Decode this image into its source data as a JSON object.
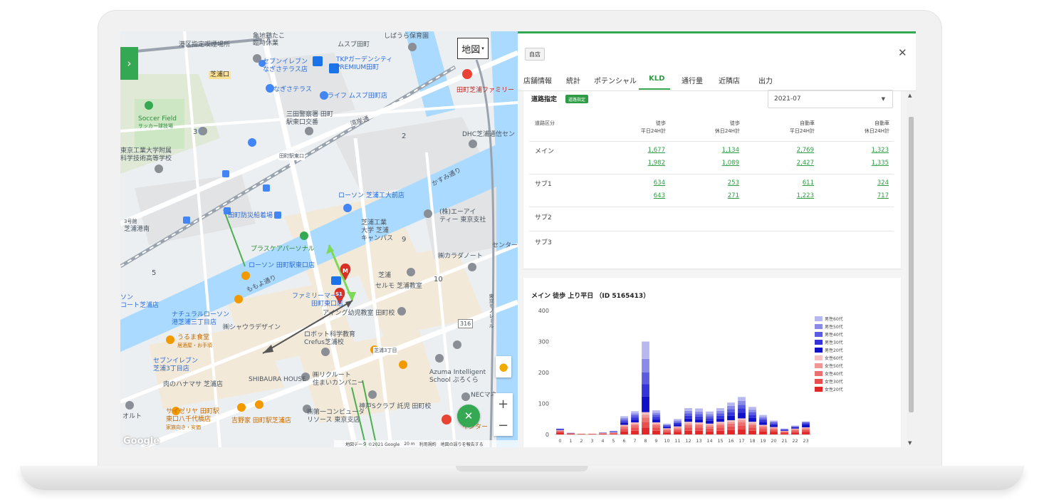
{
  "map": {
    "type_button": "地図",
    "labels": {
      "l1": "港区指定喫煙場所",
      "l2": "亀地鶏たこ",
      "l3": "臨時休業",
      "l4": "ムスブ田町",
      "l5": "しばうら保育園",
      "l6": "セブンイレブン",
      "l7": "なぎさテラス店",
      "l8": "TKPガーデンシティ",
      "l9": "PREMIUM田町",
      "l10": "芝浦口",
      "l11": "なぎさテラス",
      "l12": "ライフ ムスブ田町店",
      "l13": "田町芝浦ファミリー",
      "l14": "Soccer Field",
      "l15": "サッカー球技場",
      "l16": "三田警察署 田町",
      "l17": "駅東口交番",
      "l18": "湾岸通",
      "l19": "DHC芝浦通信セン",
      "l20": "東京工業大学附属",
      "l21": "科学技術高等学校",
      "l22": "田町駅東口",
      "l23": "かすみ通り",
      "l24": "ローソン 芝浦工大前店",
      "l25": "田町防災船着場",
      "l26": "(株)エーアイ",
      "l27": "ティー 東京支社",
      "l28": "3号館",
      "l29": "芝浦港南",
      "l30": "芝浦工業",
      "l31": "大学 芝浦",
      "l32": "キャンパス",
      "l33": "センター",
      "l34": "プラスケアパーソナル",
      "l35": "㈱カラダノート",
      "l36": "ローソン 田町駅東口店",
      "l37": "芝浦",
      "l38": "ももよ通り",
      "l39": "ファミリーマート",
      "l40": "田町東口店",
      "l41": "セルモ 芝浦教室",
      "l42": "ソン",
      "l43": "コート芝浦店",
      "l44": "アイング幼児教室 田町校",
      "l45": "ナチュラルローソン",
      "l46": "港芝浦三丁目店",
      "l47": "東京モノレール",
      "l48": "うるま食堂",
      "l49": "居酒屋・お手頃",
      "l50": "㈱シャウラデザイン",
      "l51": "ロボット科学教育",
      "l52": "Crefus芝浦校",
      "l53": "芝浦3丁目",
      "l54": "セブンイレブン",
      "l55": "芝浦3丁目店",
      "l56": "Azuma Intelligent",
      "l57": "School ぷろくら",
      "l58": "肉のハナマサ 芝浦店",
      "l59": "SHIBAURA HOUSE",
      "l60": "㈱リクルート",
      "l61": "住まいカンパニー",
      "l62": "NECマネ",
      "l63": "オルト",
      "l64": "サイゼリヤ 田町駅",
      "l65": "東口八千代橋店",
      "l66": "家族向き・安価",
      "l67": "吉野家 田町駅芝浦店",
      "l68": "㈱第一コンピュータ",
      "l69": "リソース 東京支店",
      "l70": "神戸Sクラブ 託児 田町校",
      "l71": "メン",
      "l72": "インター",
      "l73": "Google"
    },
    "numbers": [
      "3",
      "2",
      "9",
      "10",
      "5"
    ],
    "route_badge": "316",
    "markers": {
      "m": "M",
      "s1": "S1"
    },
    "footer": {
      "data": "地図データ ©2021 Google",
      "scale": "20 m",
      "terms": "利用規約",
      "report": "地図の誤りを報告する"
    }
  },
  "panel": {
    "store_badge": "自店",
    "tabs": [
      "店舗情報",
      "統計",
      "ポテンシャル",
      "KLD",
      "通行量",
      "近隣店",
      "出力"
    ],
    "active_tab": "KLD",
    "road": {
      "title": "道路指定",
      "badge": "道路指定",
      "month": "2021-07",
      "headers": [
        {
          "line1": "道路区分",
          "line2": ""
        },
        {
          "line1": "徒歩",
          "line2": "平日24H計"
        },
        {
          "line1": "徒歩",
          "line2": "休日24H計"
        },
        {
          "line1": "自動車",
          "line2": "平日24H計"
        },
        {
          "line1": "自動車",
          "line2": "休日24H計"
        }
      ],
      "rows": [
        {
          "label": "メイン",
          "values": [
            [
              "1,677",
              "1,982"
            ],
            [
              "1,134",
              "1,089"
            ],
            [
              "2,769",
              "2,427"
            ],
            [
              "1,323",
              "1,335"
            ]
          ]
        },
        {
          "label": "サブ1",
          "values": [
            [
              "634",
              "643"
            ],
            [
              "253",
              "271"
            ],
            [
              "611",
              "1,223"
            ],
            [
              "324",
              "717"
            ]
          ]
        },
        {
          "label": "サブ2",
          "values": []
        },
        {
          "label": "サブ3",
          "values": []
        }
      ]
    },
    "chart_title": "メイン 徒歩 上り平日 （ID 5165413）"
  },
  "chart_data": {
    "type": "bar",
    "stacked": true,
    "title": "メイン 徒歩 上り平日 （ID 5165413）",
    "categories": [
      "0",
      "1",
      "2",
      "3",
      "4",
      "5",
      "6",
      "7",
      "8",
      "9",
      "10",
      "11",
      "12",
      "13",
      "14",
      "15",
      "16",
      "17",
      "18",
      "19",
      "20",
      "21",
      "22",
      "23"
    ],
    "ylim": [
      0,
      400
    ],
    "yticks": [
      "0",
      "100",
      "200",
      "300",
      "400"
    ],
    "legend_position": "right",
    "series": [
      {
        "name": "女性20代",
        "color": "#e02828",
        "values": [
          6,
          2,
          1,
          1,
          2,
          2,
          10,
          12,
          22,
          12,
          6,
          8,
          12,
          12,
          10,
          12,
          14,
          16,
          12,
          10,
          8,
          4,
          6,
          8
        ]
      },
      {
        "name": "女性30代",
        "color": "#e85050",
        "values": [
          4,
          1,
          1,
          1,
          1,
          2,
          8,
          10,
          18,
          10,
          5,
          6,
          10,
          10,
          9,
          10,
          12,
          13,
          10,
          8,
          6,
          3,
          5,
          6
        ]
      },
      {
        "name": "女性40代",
        "color": "#ec7070",
        "values": [
          2,
          1,
          0,
          0,
          1,
          1,
          6,
          8,
          14,
          8,
          4,
          5,
          8,
          8,
          7,
          8,
          9,
          10,
          8,
          6,
          5,
          2,
          4,
          4
        ]
      },
      {
        "name": "女性50代",
        "color": "#f09696",
        "values": [
          1,
          0,
          0,
          0,
          1,
          1,
          4,
          5,
          10,
          5,
          3,
          4,
          6,
          5,
          5,
          6,
          6,
          7,
          6,
          4,
          3,
          2,
          2,
          3
        ]
      },
      {
        "name": "女性60代",
        "color": "#f5c0c0",
        "values": [
          1,
          0,
          0,
          0,
          0,
          1,
          3,
          4,
          8,
          4,
          2,
          3,
          5,
          4,
          4,
          5,
          5,
          6,
          5,
          3,
          2,
          1,
          2,
          2
        ]
      },
      {
        "name": "男性20代",
        "color": "#1010c8",
        "values": [
          2,
          1,
          0,
          0,
          1,
          1,
          6,
          8,
          50,
          10,
          4,
          6,
          10,
          10,
          9,
          10,
          14,
          18,
          12,
          8,
          6,
          2,
          3,
          8
        ]
      },
      {
        "name": "男性30代",
        "color": "#3434d8",
        "values": [
          1,
          0,
          0,
          0,
          0,
          1,
          6,
          8,
          40,
          8,
          3,
          5,
          9,
          9,
          8,
          9,
          12,
          14,
          10,
          7,
          5,
          2,
          2,
          5
        ]
      },
      {
        "name": "男性40代",
        "color": "#5c5ce0",
        "values": [
          1,
          0,
          0,
          0,
          0,
          1,
          5,
          7,
          38,
          7,
          3,
          4,
          8,
          8,
          7,
          8,
          10,
          12,
          9,
          6,
          4,
          1,
          2,
          3
        ]
      },
      {
        "name": "男性50代",
        "color": "#8a8ae8",
        "values": [
          1,
          0,
          0,
          0,
          0,
          1,
          5,
          6,
          44,
          6,
          2,
          4,
          8,
          8,
          7,
          8,
          10,
          12,
          8,
          5,
          3,
          1,
          1,
          2
        ]
      },
      {
        "name": "男性60代",
        "color": "#b8b8f0",
        "values": [
          1,
          0,
          0,
          0,
          0,
          1,
          6,
          7,
          56,
          8,
          3,
          5,
          9,
          10,
          8,
          9,
          11,
          13,
          9,
          6,
          3,
          1,
          2,
          1
        ]
      }
    ],
    "legend_order": [
      "男性60代",
      "男性50代",
      "男性40代",
      "男性30代",
      "男性20代",
      "女性60代",
      "女性50代",
      "女性40代",
      "女性30代",
      "女性20代"
    ]
  }
}
